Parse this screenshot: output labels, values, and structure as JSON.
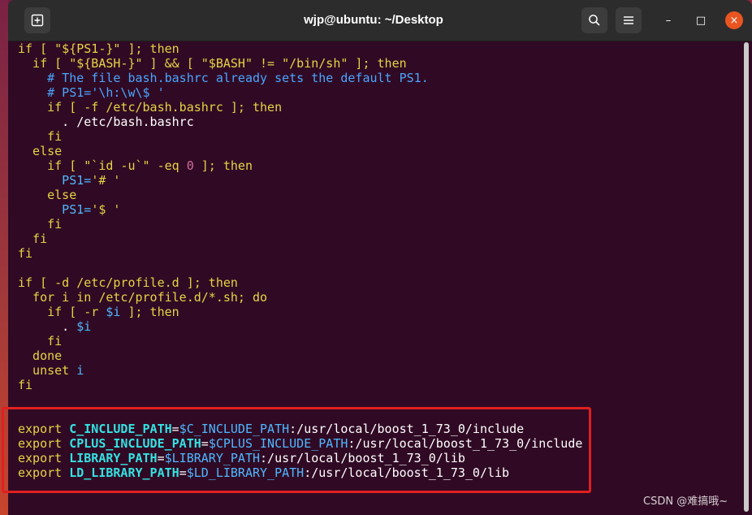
{
  "window": {
    "title": "wjp@ubuntu: ~/Desktop",
    "buttons": {
      "new_tab_icon": "plus-in-square",
      "search_icon": "magnifier",
      "menu_icon": "hamburger",
      "minimize": "–",
      "maximize": "□",
      "close": "×"
    },
    "accent_close": "#e95420",
    "terminal_bg": "#300a24"
  },
  "terminal": {
    "lines": [
      [
        {
          "t": "if [ ",
          "c": "kw"
        },
        {
          "t": "\"${PS1-}\"",
          "c": "str"
        },
        {
          "t": " ]; then",
          "c": "kw"
        }
      ],
      [
        {
          "t": "  if [ ",
          "c": "kw"
        },
        {
          "t": "\"${BASH-}\"",
          "c": "str"
        },
        {
          "t": " ] && [ ",
          "c": "kw"
        },
        {
          "t": "\"$BASH\"",
          "c": "str"
        },
        {
          "t": " != ",
          "c": "kw"
        },
        {
          "t": "\"/bin/sh\"",
          "c": "str"
        },
        {
          "t": " ]; then",
          "c": "kw"
        }
      ],
      [
        {
          "t": "    # The file bash.bashrc already sets the default PS1.",
          "c": "cm"
        }
      ],
      [
        {
          "t": "    # PS1='\\h:\\w\\$ '",
          "c": "cm"
        }
      ],
      [
        {
          "t": "    if [ -f /etc/bash.bashrc ]; then",
          "c": "kw"
        }
      ],
      [
        {
          "t": "      . /etc/bash.bashrc",
          "c": ""
        }
      ],
      [
        {
          "t": "    fi",
          "c": "kw"
        }
      ],
      [
        {
          "t": "  else",
          "c": "kw"
        }
      ],
      [
        {
          "t": "    if [ ",
          "c": "kw"
        },
        {
          "t": "\"`id -u`\"",
          "c": "str"
        },
        {
          "t": " -eq ",
          "c": "kw"
        },
        {
          "t": "0",
          "c": "num"
        },
        {
          "t": " ]; then",
          "c": "kw"
        }
      ],
      [
        {
          "t": "      PS1=",
          "c": "var"
        },
        {
          "t": "'# '",
          "c": "str"
        }
      ],
      [
        {
          "t": "    else",
          "c": "kw"
        }
      ],
      [
        {
          "t": "      PS1=",
          "c": "var"
        },
        {
          "t": "'$ '",
          "c": "str"
        }
      ],
      [
        {
          "t": "    fi",
          "c": "kw"
        }
      ],
      [
        {
          "t": "  fi",
          "c": "kw"
        }
      ],
      [
        {
          "t": "fi",
          "c": "kw"
        }
      ],
      [
        {
          "t": "",
          "c": ""
        }
      ],
      [
        {
          "t": "if [ -d /etc/profile.d ]; then",
          "c": "kw"
        }
      ],
      [
        {
          "t": "  for i in /etc/profile.d/*.sh; do",
          "c": "kw"
        }
      ],
      [
        {
          "t": "    if [ -r ",
          "c": "kw"
        },
        {
          "t": "$i",
          "c": "var"
        },
        {
          "t": " ]; then",
          "c": "kw"
        }
      ],
      [
        {
          "t": "      . ",
          "c": ""
        },
        {
          "t": "$i",
          "c": "var"
        }
      ],
      [
        {
          "t": "    fi",
          "c": "kw"
        }
      ],
      [
        {
          "t": "  done",
          "c": "kw"
        }
      ],
      [
        {
          "t": "  unset ",
          "c": "kw"
        },
        {
          "t": "i",
          "c": "var"
        }
      ],
      [
        {
          "t": "fi",
          "c": "kw"
        }
      ],
      [
        {
          "t": "",
          "c": ""
        }
      ],
      [
        {
          "t": "",
          "c": ""
        }
      ],
      [
        {
          "t": "export ",
          "c": "kw"
        },
        {
          "t": "C_INCLUDE_PATH",
          "c": "cyan"
        },
        {
          "t": "=",
          "c": ""
        },
        {
          "t": "$C_INCLUDE_PATH",
          "c": "var"
        },
        {
          "t": ":/usr/local/boost_1_73_0/include",
          "c": ""
        }
      ],
      [
        {
          "t": "export ",
          "c": "kw"
        },
        {
          "t": "CPLUS_INCLUDE_PATH",
          "c": "cyan"
        },
        {
          "t": "=",
          "c": ""
        },
        {
          "t": "$CPLUS_INCLUDE_PATH",
          "c": "var"
        },
        {
          "t": ":/usr/local/boost_1_73_0/include",
          "c": ""
        }
      ],
      [
        {
          "t": "export ",
          "c": "kw"
        },
        {
          "t": "LIBRARY_PATH",
          "c": "cyan"
        },
        {
          "t": "=",
          "c": ""
        },
        {
          "t": "$LIBRARY_PATH",
          "c": "var"
        },
        {
          "t": ":/usr/local/boost_1_73_0/lib",
          "c": ""
        }
      ],
      [
        {
          "t": "export ",
          "c": "kw"
        },
        {
          "t": "LD_LIBRARY_PATH",
          "c": "cyan"
        },
        {
          "t": "=",
          "c": ""
        },
        {
          "t": "$LD_LIBRARY_PATH",
          "c": "var"
        },
        {
          "t": ":/usr/local/boost_1_73_0/lib",
          "c": ""
        }
      ]
    ]
  },
  "watermark": "CSDN @难搞哦~"
}
